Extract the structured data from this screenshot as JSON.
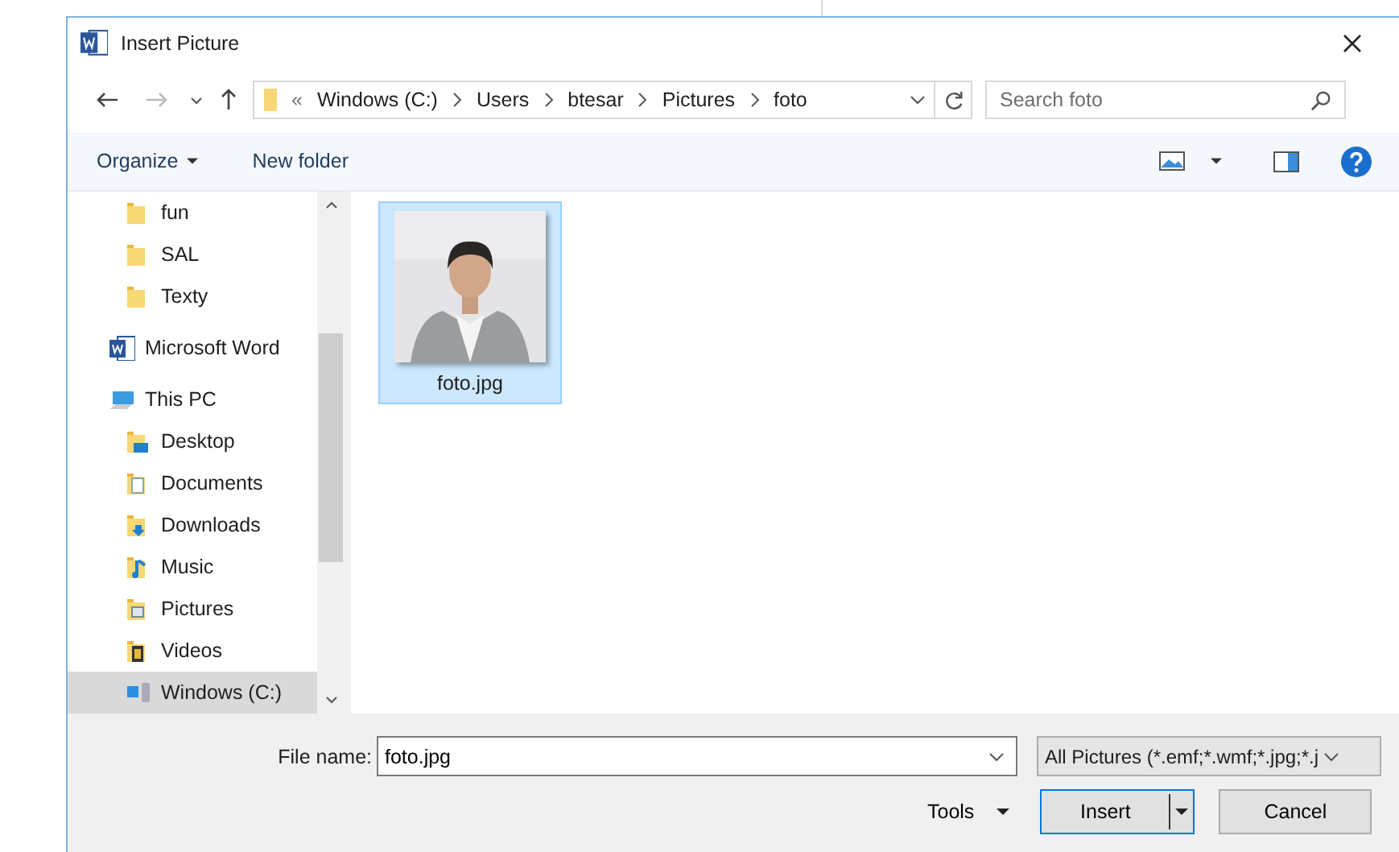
{
  "window": {
    "title": "Insert Picture"
  },
  "address": {
    "overflow_mark": "«",
    "path": [
      "Windows (C:)",
      "Users",
      "btesar",
      "Pictures",
      "foto"
    ]
  },
  "search": {
    "placeholder": "Search foto"
  },
  "toolbar": {
    "organize": "Organize",
    "new_folder": "New folder"
  },
  "nav": [
    {
      "label": "fun",
      "kind": "folder",
      "selected": false
    },
    {
      "label": "SAL",
      "kind": "folder",
      "selected": false
    },
    {
      "label": "Texty",
      "kind": "folder",
      "selected": false
    },
    {
      "label": "Microsoft Word",
      "kind": "word",
      "selected": false
    },
    {
      "label": "This PC",
      "kind": "pc",
      "selected": false,
      "children": [
        {
          "label": "Desktop",
          "kind": "desktop",
          "selected": false
        },
        {
          "label": "Documents",
          "kind": "documents",
          "selected": false
        },
        {
          "label": "Downloads",
          "kind": "downloads",
          "selected": false
        },
        {
          "label": "Music",
          "kind": "music",
          "selected": false
        },
        {
          "label": "Pictures",
          "kind": "pictures",
          "selected": false
        },
        {
          "label": "Videos",
          "kind": "videos",
          "selected": false
        },
        {
          "label": "Windows (C:)",
          "kind": "drive",
          "selected": true
        }
      ]
    }
  ],
  "files": [
    {
      "name": "foto.jpg",
      "kind": "picture",
      "selected": true
    }
  ],
  "footer": {
    "file_name_label": "File name:",
    "file_name": "foto.jpg",
    "file_type": "All Pictures (*.emf;*.wmf;*.jpg;*.j",
    "tools": "Tools",
    "insert": "Insert",
    "cancel": "Cancel"
  }
}
